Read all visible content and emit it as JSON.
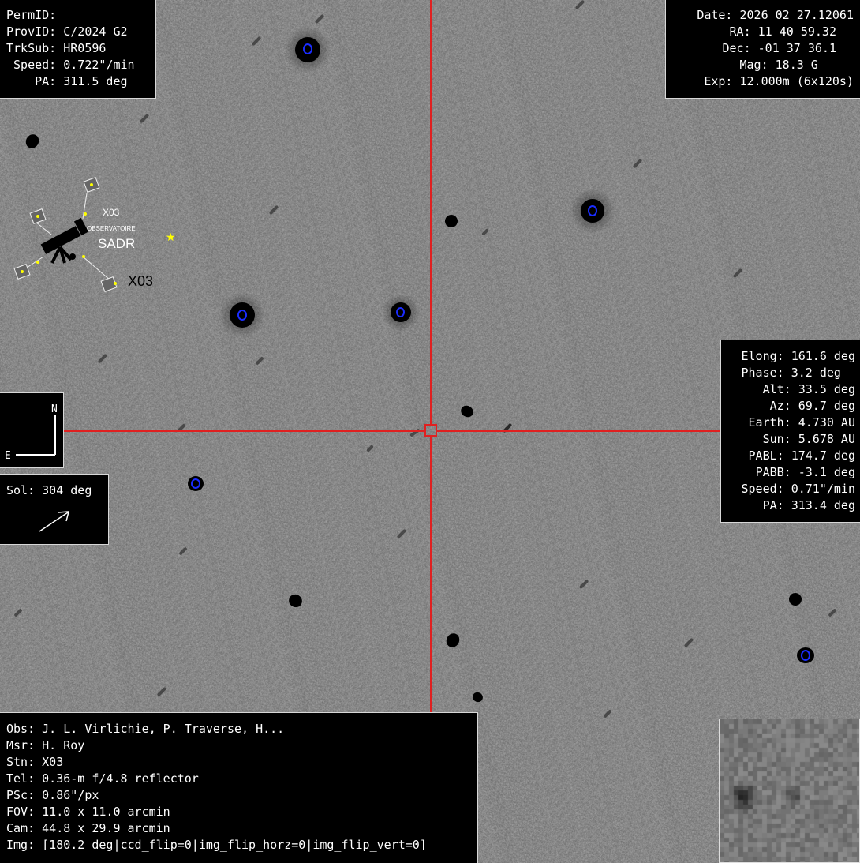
{
  "top_left": {
    "permid": "PermID:",
    "provid": "ProvID: C/2024 G2",
    "trksub": "TrkSub: HR0596",
    "speed": " Speed: 0.722\"/min",
    "pa": "    PA: 311.5 deg"
  },
  "top_right": {
    "date": "Date: 2026 02 27.12061",
    "ra": "RA: 11 40 59.32",
    "dec": "Dec: -01 37 36.1",
    "mag": "Mag: 18.3 G     ",
    "exp": "Exp: 12.000m (6x120s)"
  },
  "mid_right": {
    "elong": "Elong: 161.6 deg",
    "phase": "Phase: 3.2 deg  ",
    "alt": "Alt: 33.5 deg",
    "az": "Az: 69.7 deg",
    "earth": "Earth: 4.730 AU",
    "sun": "Sun: 5.678 AU",
    "pabl": "PABL: 174.7 deg",
    "pabb": "PABB: -3.1 deg",
    "speed": "Speed: 0.71\"/min",
    "pa": "PA: 313.4 deg"
  },
  "bottom_left": {
    "obs": "Obs: J. L. Virlichie, P. Traverse, H...",
    "msr": "Msr: H. Roy",
    "stn": "Stn: X03",
    "tel": "Tel: 0.36-m f/4.8 reflector",
    "psc": "PSc: 0.86\"/px",
    "fov": "FOV: 11.0 x 11.0 arcmin",
    "cam": "Cam: 44.8 x 29.9 arcmin",
    "img": "Img: [180.2 deg|ccd_flip=0|img_flip_horz=0|img_flip_vert=0]"
  },
  "compass": {
    "north": "N",
    "east": "E"
  },
  "sol": {
    "label": "Sol: 304 deg"
  },
  "logo": {
    "code_small": "X03",
    "subtitle": "OBSERVATOIRE",
    "name": "SADR",
    "code_large": "X03"
  },
  "colors": {
    "crosshair": "#e02020",
    "ring": "#1a2cff",
    "background": "#8e8e8e"
  }
}
